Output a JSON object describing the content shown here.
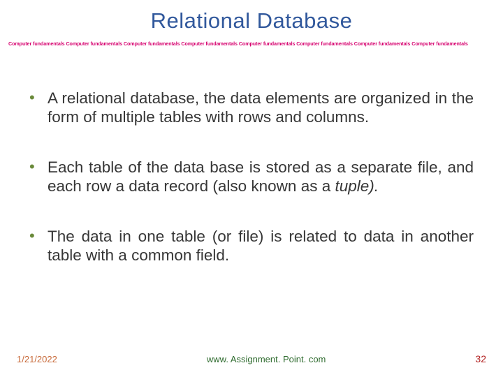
{
  "title": "Relational Database",
  "ruler_segment": "Computer fundamentals ",
  "ruler_repeat": 8,
  "bullets": [
    {
      "text": "A relational database, the data elements are organized in the form of multiple tables with rows and columns."
    },
    {
      "prefix": "Each table of the data base is stored as a separate file, and each row a data record (also known as a ",
      "emph": "tuple).",
      "suffix": ""
    },
    {
      "text": "The data in one table (or file) is related to data in another table with a common field."
    }
  ],
  "footer": {
    "date": "1/21/2022",
    "link": "www. Assignment. Point. com",
    "page": "32"
  },
  "colors": {
    "title": "#31589c",
    "ruler": "#d6006e",
    "bullet_dot": "#6a8a3a",
    "date": "#c86a3a",
    "link": "#2e6b2e",
    "page": "#b22222"
  }
}
